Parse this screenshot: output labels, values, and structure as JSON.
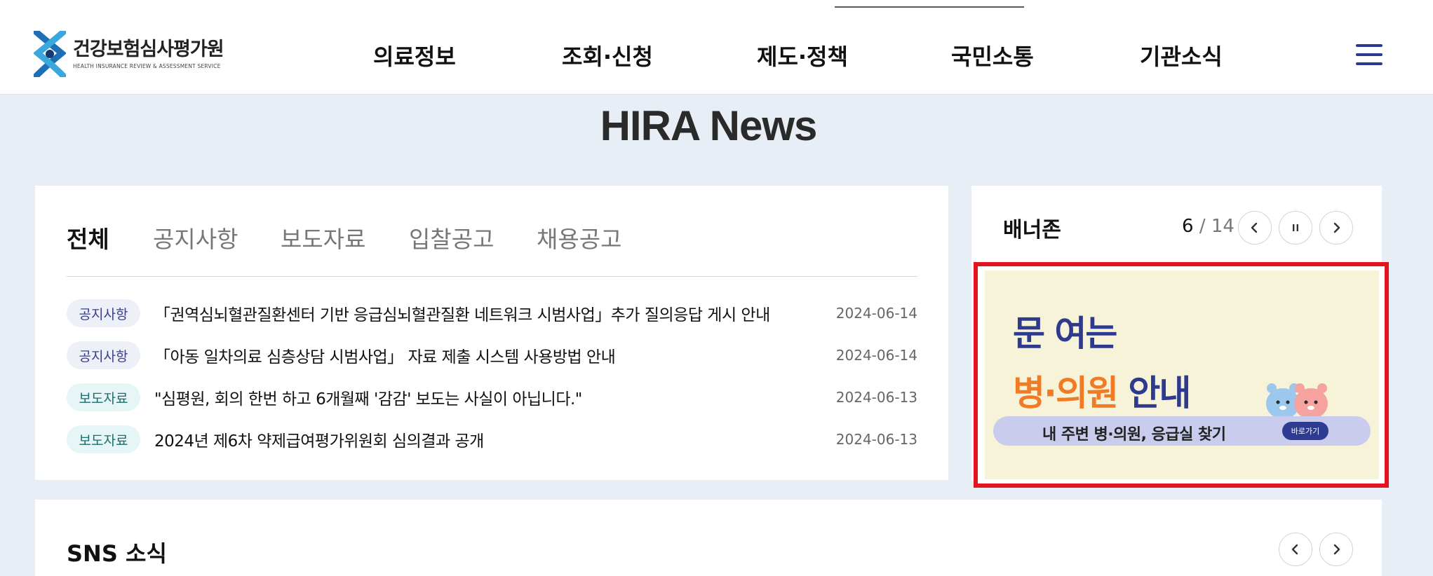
{
  "header": {
    "logo": {
      "name_ko": "건강보험심사평가원",
      "name_en": "HEALTH INSURANCE REVIEW & ASSESSMENT SERVICE",
      "icon": "hira-logo-icon"
    },
    "nav": [
      {
        "label": "의료정보"
      },
      {
        "label": "조회·신청"
      },
      {
        "label": "제도·정책"
      },
      {
        "label": "국민소통"
      },
      {
        "label": "기관소식"
      }
    ],
    "menu_icon": "hamburger-icon"
  },
  "main": {
    "title": "HIRA News"
  },
  "news": {
    "tabs": [
      {
        "label": "전체",
        "active": true
      },
      {
        "label": "공지사항",
        "active": false
      },
      {
        "label": "보도자료",
        "active": false
      },
      {
        "label": "입찰공고",
        "active": false
      },
      {
        "label": "채용공고",
        "active": false
      }
    ],
    "items": [
      {
        "category": "공지사항",
        "title": "「권역심뇌혈관질환센터 기반 응급심뇌혈관질환 네트워크 시범사업」추가 질의응답 게시 안내",
        "date": "2024-06-14"
      },
      {
        "category": "공지사항",
        "title": "「아동 일차의료 심층상담 시범사업」 자료 제출 시스템 사용방법 안내",
        "date": "2024-06-14"
      },
      {
        "category": "보도자료",
        "title": "\"심평원, 회의 한번 하고 6개월째 '감감' 보도는 사실이 아닙니다.\"",
        "date": "2024-06-13"
      },
      {
        "category": "보도자료",
        "title": "2024년 제6차 약제급여평가위원회 심의결과 공개",
        "date": "2024-06-13"
      }
    ]
  },
  "banner": {
    "heading": "배너존",
    "current": "6",
    "separator": "/",
    "total": "14",
    "prev_icon": "chevron-left-icon",
    "pause_icon": "pause-icon",
    "next_icon": "chevron-right-icon",
    "slide": {
      "line1": "문 여는",
      "line2_highlight": "병·의원",
      "line2_rest": " 안내",
      "bar_text": "내 주변 병·의원, 응급실 찾기",
      "button": "바로가기"
    }
  },
  "sns": {
    "title": "SNS 소식",
    "prev_icon": "chevron-left-icon",
    "next_icon": "chevron-right-icon"
  },
  "colors": {
    "accent_blue": "#2e3a8e",
    "banner_orange": "#f07b24",
    "highlight_red": "#e3141f",
    "page_bg": "#e8eef5"
  }
}
